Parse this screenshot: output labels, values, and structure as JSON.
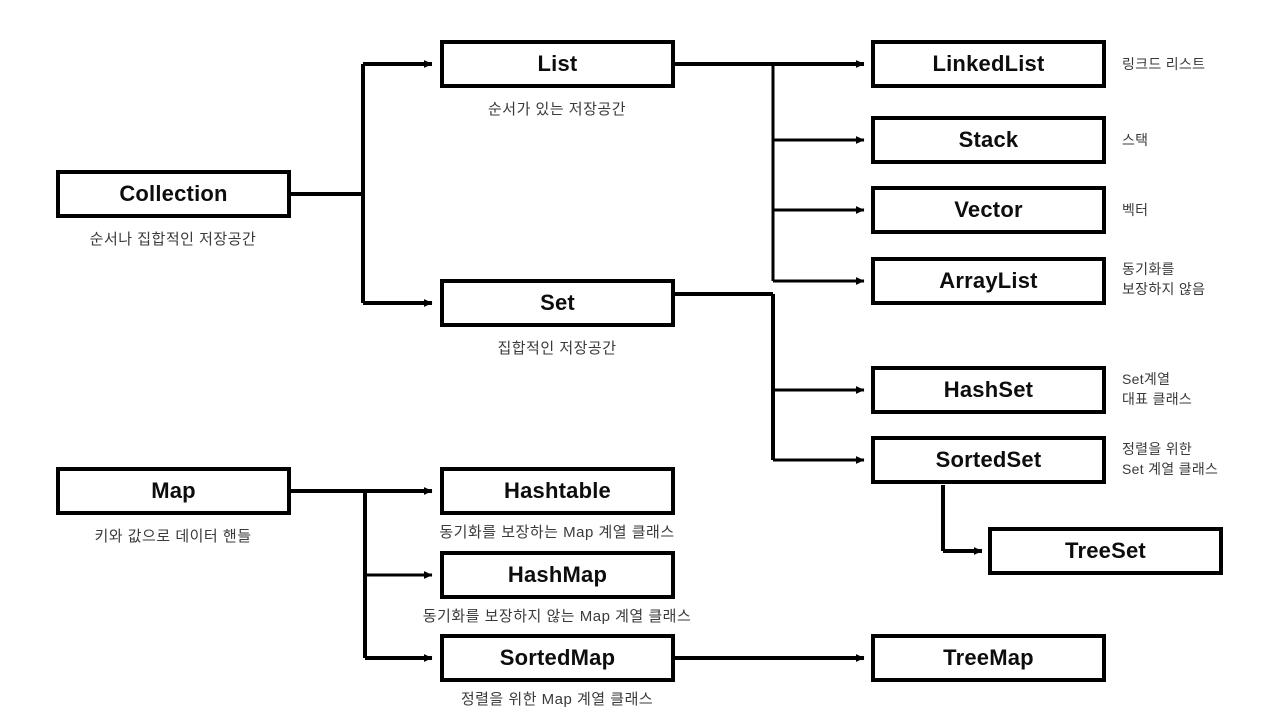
{
  "diagram": {
    "title": "Java Collection and Map hierarchy",
    "stroke_color": "#000000",
    "box_fill": "#ffffff",
    "caption_color": "#3a3a3a"
  },
  "nodes": {
    "collection": {
      "label": "Collection",
      "caption": "순서나 집합적인 저장공간"
    },
    "list": {
      "label": "List",
      "caption": "순서가 있는 저장공간"
    },
    "set": {
      "label": "Set",
      "caption": "집합적인 저장공간"
    },
    "linkedlist": {
      "label": "LinkedList",
      "annotation": "링크드 리스트"
    },
    "stack": {
      "label": "Stack",
      "annotation": "스택"
    },
    "vector": {
      "label": "Vector",
      "annotation": "벡터"
    },
    "arraylist": {
      "label": "ArrayList",
      "annotation": "동기화를\n보장하지 않음"
    },
    "hashset": {
      "label": "HashSet",
      "annotation": "Set계열\n대표 클래스"
    },
    "sortedset": {
      "label": "SortedSet",
      "annotation": "정렬을 위한\nSet 계열 클래스"
    },
    "treeset": {
      "label": "TreeSet",
      "annotation": ""
    },
    "map": {
      "label": "Map",
      "caption": "키와 값으로 데이터 핸들"
    },
    "hashtable": {
      "label": "Hashtable",
      "caption": "동기화를 보장하는 Map 계열 클래스"
    },
    "hashmap": {
      "label": "HashMap",
      "caption": "동기화를 보장하지 않는 Map 계열 클래스"
    },
    "sortedmap": {
      "label": "SortedMap",
      "caption": "정렬을 위한 Map 계열 클래스"
    },
    "treemap": {
      "label": "TreeMap",
      "annotation": ""
    }
  }
}
